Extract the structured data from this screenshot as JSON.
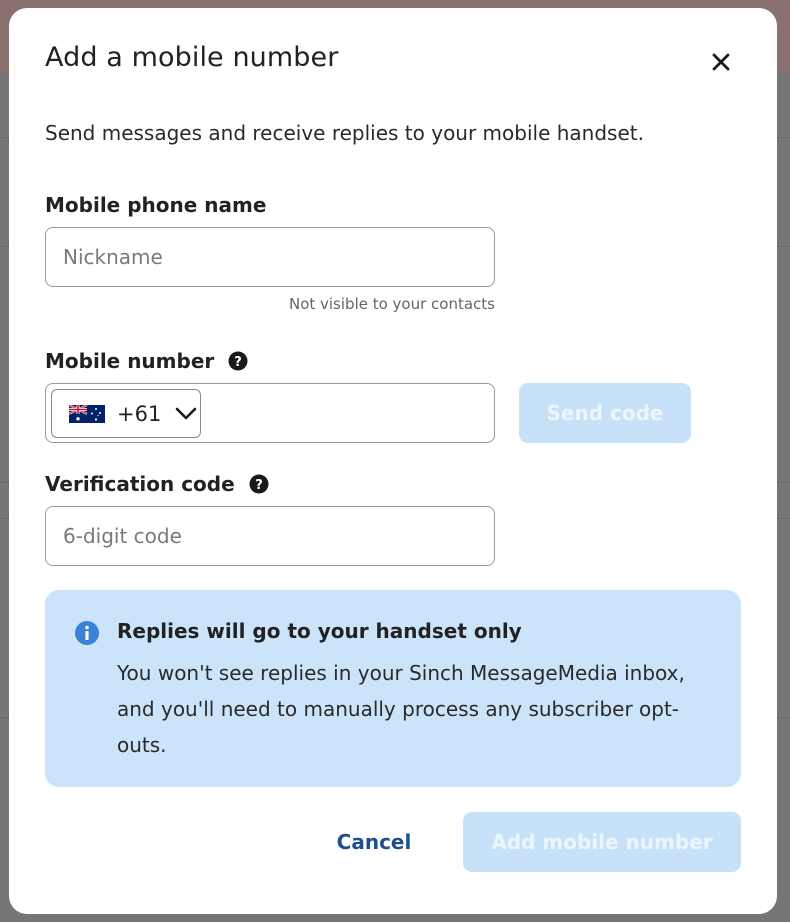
{
  "modal": {
    "title": "Add a mobile number",
    "subtitle": "Send messages and receive replies to your mobile handset."
  },
  "fields": {
    "phone_name": {
      "label": "Mobile phone name",
      "placeholder": "Nickname",
      "value": "",
      "hint": "Not visible to your contacts"
    },
    "mobile_number": {
      "label": "Mobile number",
      "country_code": "+61",
      "country_flag": "australia-flag-icon",
      "value": ""
    },
    "verification": {
      "label": "Verification code",
      "placeholder": "6-digit code",
      "value": ""
    }
  },
  "buttons": {
    "send_code": "Send code",
    "cancel": "Cancel",
    "add": "Add mobile number"
  },
  "info": {
    "title": "Replies will go to your handset only",
    "body": "You won't see replies in your Sinch MessageMedia inbox, and you'll need to manually process any subscriber opt-outs."
  },
  "colors": {
    "primary_disabled": "#c7e1f8",
    "info_bg": "#cce4fa",
    "link": "#1f4e8c",
    "info_icon": "#3b82d6"
  }
}
